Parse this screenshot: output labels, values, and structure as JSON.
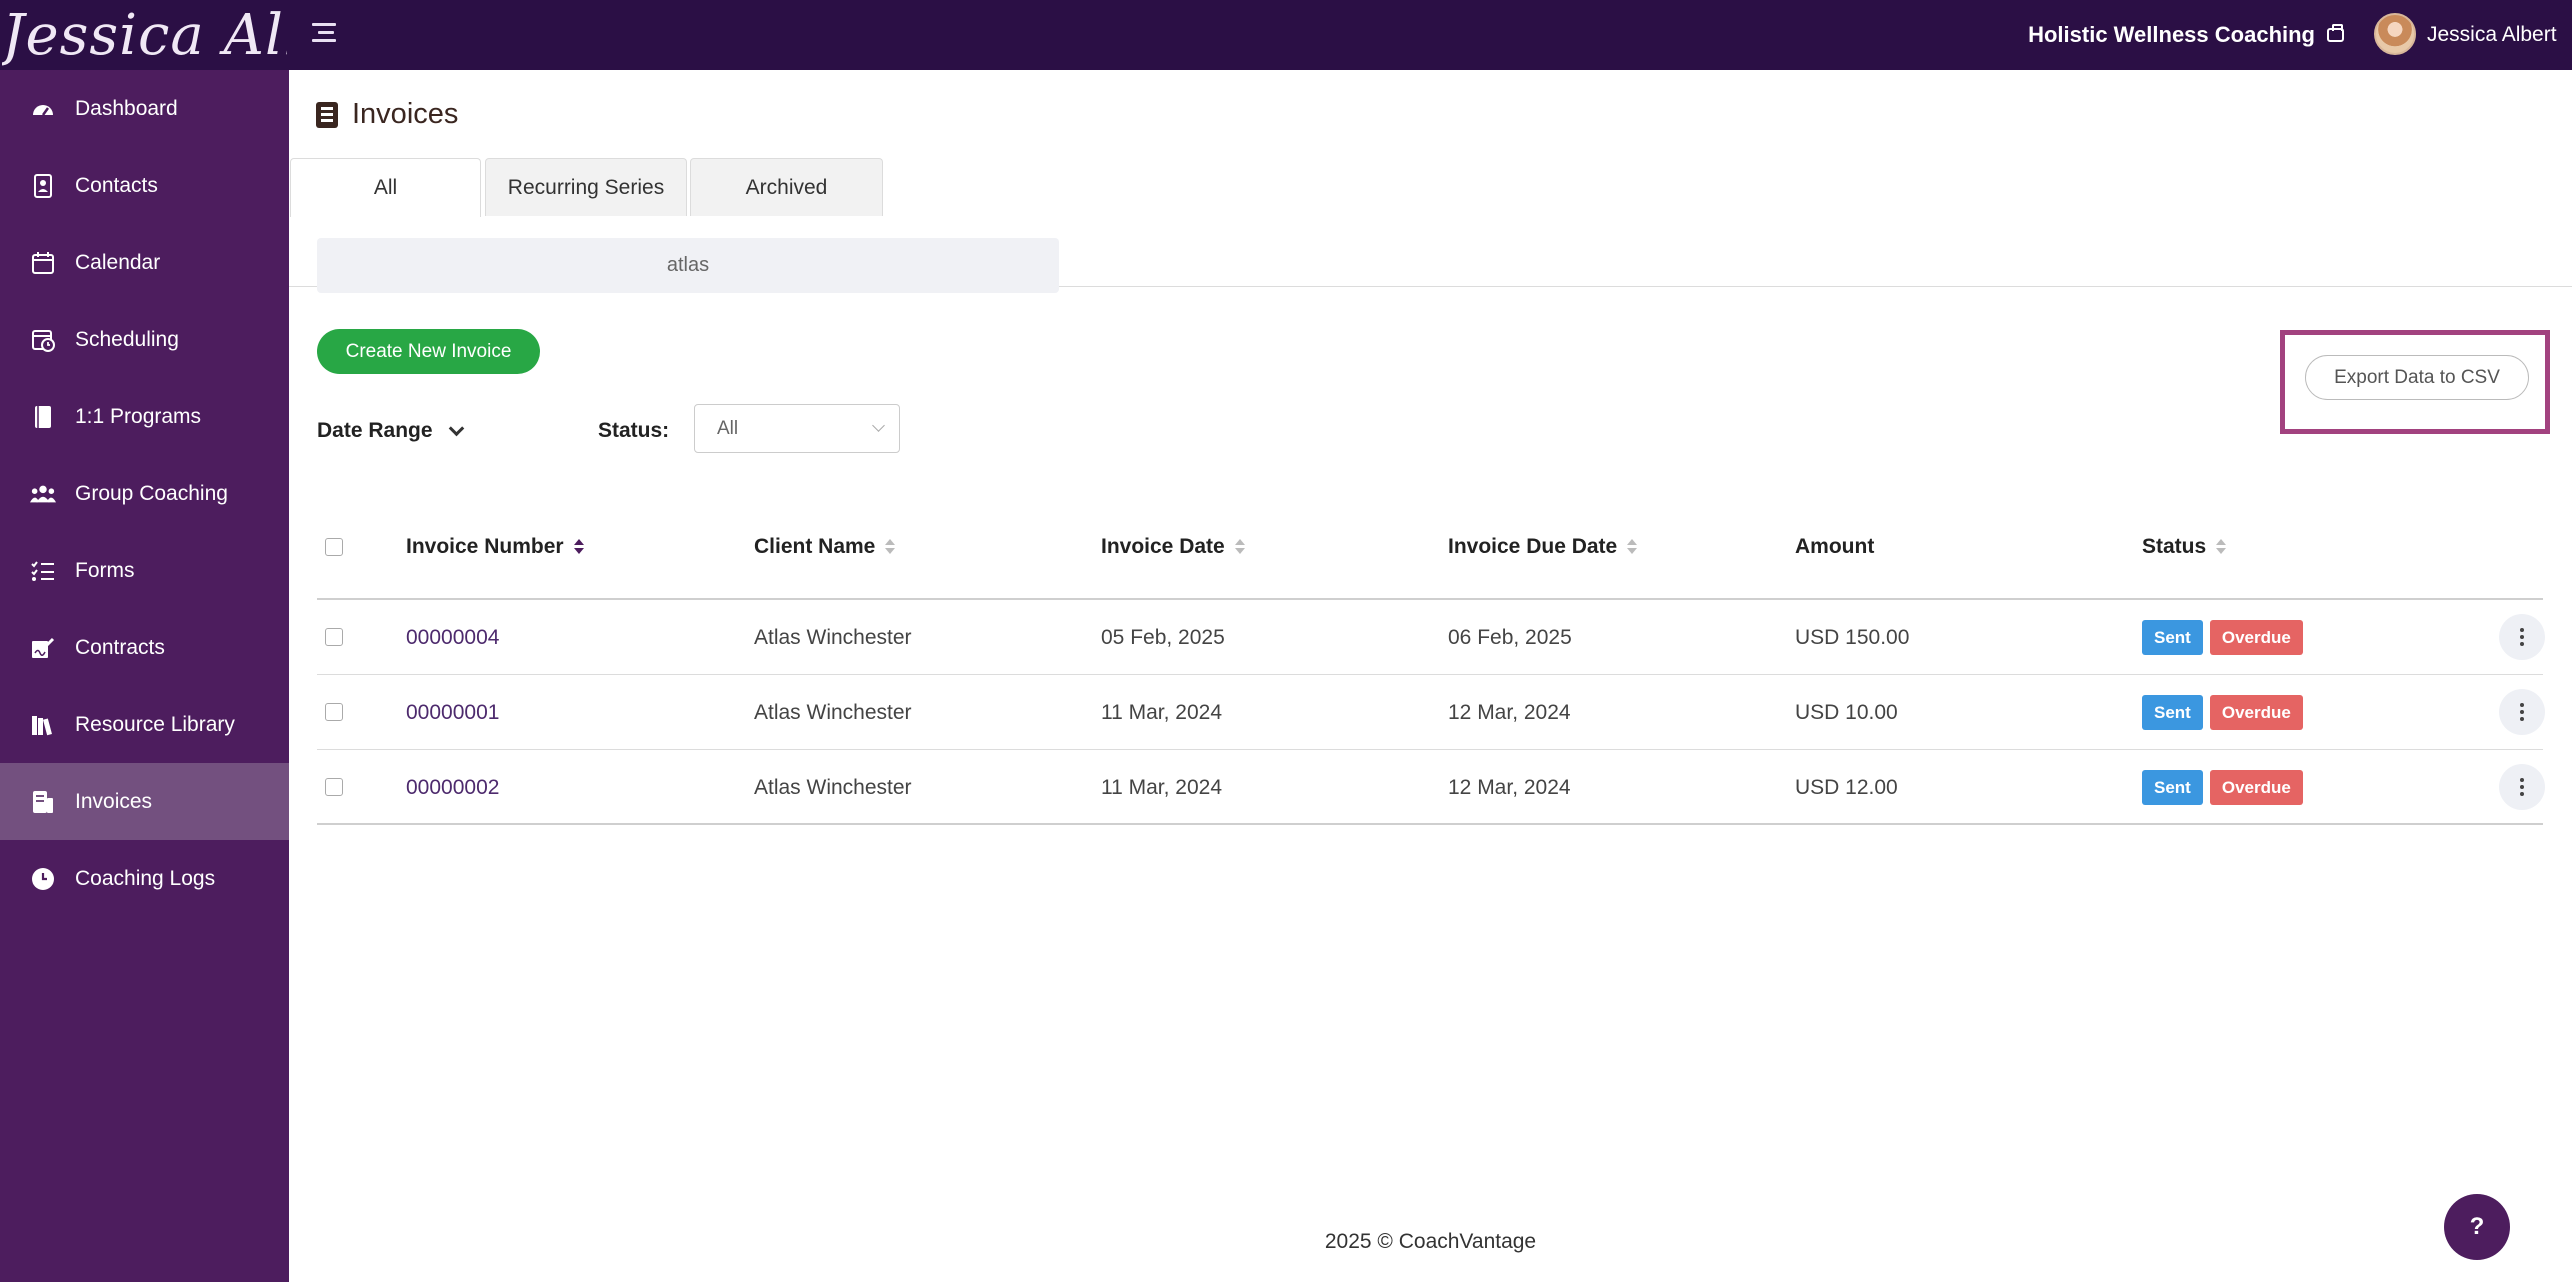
{
  "header": {
    "brand": "Jessica Albert",
    "organization": "Holistic Wellness Coaching",
    "user_name": "Jessica Albert"
  },
  "sidebar": {
    "items": [
      {
        "label": "Dashboard",
        "icon": "gauge-icon"
      },
      {
        "label": "Contacts",
        "icon": "contact-book-icon"
      },
      {
        "label": "Calendar",
        "icon": "calendar-icon"
      },
      {
        "label": "Scheduling",
        "icon": "calendar-clock-icon"
      },
      {
        "label": "1:1 Programs",
        "icon": "book-icon"
      },
      {
        "label": "Group Coaching",
        "icon": "users-icon"
      },
      {
        "label": "Forms",
        "icon": "list-check-icon"
      },
      {
        "label": "Contracts",
        "icon": "signature-icon"
      },
      {
        "label": "Resource Library",
        "icon": "library-icon"
      },
      {
        "label": "Invoices",
        "icon": "invoice-icon",
        "active": true
      },
      {
        "label": "Coaching Logs",
        "icon": "clock-icon"
      }
    ]
  },
  "page": {
    "title": "Invoices",
    "tabs": [
      "All",
      "Recurring Series",
      "Archived"
    ],
    "active_tab": "All",
    "search_value": "atlas",
    "create_button": "Create New Invoice",
    "export_button": "Export Data to CSV",
    "filters": {
      "date_range_label": "Date Range",
      "status_label": "Status:",
      "status_value": "All"
    }
  },
  "table": {
    "columns": [
      "Invoice Number",
      "Client Name",
      "Invoice Date",
      "Invoice Due Date",
      "Amount",
      "Status"
    ],
    "rows": [
      {
        "number": "00000004",
        "client": "Atlas Winchester",
        "date": "05 Feb, 2025",
        "due": "06 Feb, 2025",
        "amount": "USD 150.00",
        "badges": [
          "Sent",
          "Overdue"
        ]
      },
      {
        "number": "00000001",
        "client": "Atlas Winchester",
        "date": "11 Mar, 2024",
        "due": "12 Mar, 2024",
        "amount": "USD 10.00",
        "badges": [
          "Sent",
          "Overdue"
        ]
      },
      {
        "number": "00000002",
        "client": "Atlas Winchester",
        "date": "11 Mar, 2024",
        "due": "12 Mar, 2024",
        "amount": "USD 12.00",
        "badges": [
          "Sent",
          "Overdue"
        ]
      }
    ]
  },
  "footer": {
    "text": "2025 © CoachVantage"
  },
  "help": {
    "label": "?"
  },
  "colors": {
    "topbar": "#2b0f45",
    "sidebar": "#4d1d5e",
    "sidebar_active": "#73507f",
    "create_button": "#28a745",
    "highlight_frame": "#a2427f",
    "badge_sent": "#3b97e0",
    "badge_overdue": "#e56463"
  }
}
